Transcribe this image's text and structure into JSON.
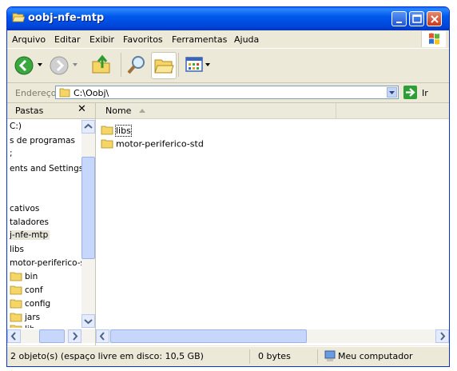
{
  "window": {
    "title": "oobj-nfe-mtp"
  },
  "menu": [
    "Arquivo",
    "Editar",
    "Exibir",
    "Favoritos",
    "Ferramentas",
    "Ajuda"
  ],
  "address": {
    "label": "Endereço",
    "value": "C:\\Oobj\\",
    "go_label": "Ir"
  },
  "folders_pane": {
    "title": "Pastas",
    "close": "✕",
    "tree": [
      "C:)",
      "s de programas",
      ";",
      "ents and Settings",
      "cativos",
      "taladores",
      "j-nfe-mtp",
      "libs",
      "motor-periferico-s",
      "bin",
      "conf",
      "config",
      "jars",
      "lib"
    ]
  },
  "list": {
    "column_name": "Nome",
    "items": [
      "libs",
      "motor-periferico-std"
    ]
  },
  "status": {
    "objects": "2 objeto(s) (espaço livre em disco: 10,5 GB)",
    "size": "0 bytes",
    "location": "Meu computador"
  },
  "colors": {
    "titlebar": "#0054e3",
    "folder": "#f5d565",
    "face": "#ece9d8"
  }
}
